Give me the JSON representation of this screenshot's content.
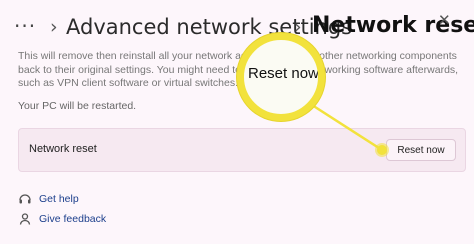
{
  "header": {
    "more_label": "···",
    "separator": "›",
    "parent": "Advanced network settings",
    "current": "Network reset",
    "close_glyph": "✕"
  },
  "description": "This will remove then reinstall all your network adapters, and set other networking components back to their original settings. You might need to reinstall other networking software afterwards, such as VPN client software or virtual switches.",
  "restart_notice": "Your PC will be restarted.",
  "card": {
    "label": "Network reset",
    "button_label": "Reset now"
  },
  "callout": {
    "zoom_text": "Reset now",
    "color": "#f2e23c"
  },
  "links": [
    {
      "label": "Get help",
      "icon": "help-icon"
    },
    {
      "label": "Give feedback",
      "icon": "feedback-icon"
    }
  ]
}
